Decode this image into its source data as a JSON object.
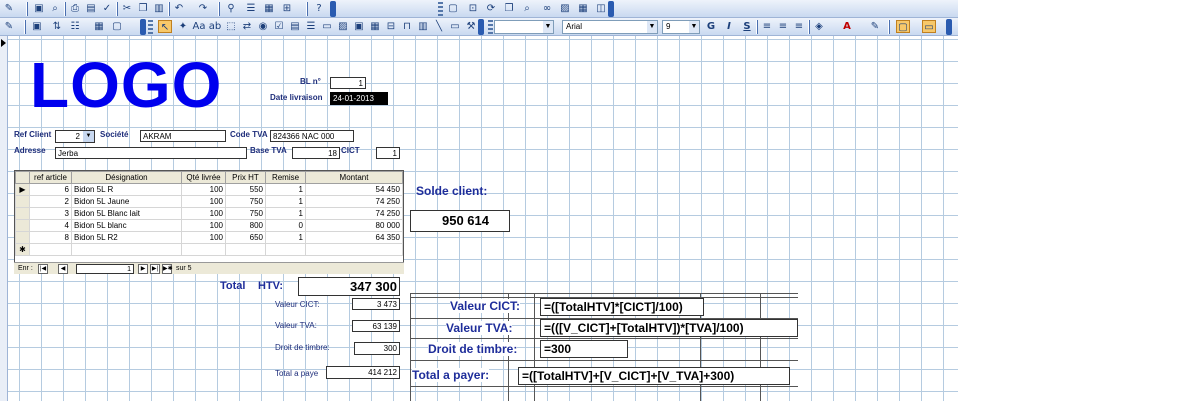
{
  "toolbar": {
    "font_name": "Arial",
    "font_size": "9"
  },
  "logo_text": "LOGO",
  "header": {
    "bl_label": "BL n°",
    "bl_value": "1",
    "date_label": "Date livraison",
    "date_value": "24-01-2013"
  },
  "client": {
    "ref_label": "Ref Client",
    "ref_value": "2",
    "societe_label": "Société",
    "societe_value": "AKRAM",
    "codetva_label": "Code TVA",
    "codetva_value": "824366 NAC 000",
    "adresse_label": "Adresse",
    "adresse_value": "Jerba",
    "basetva_label": "Base TVA",
    "basetva_value": "18",
    "cict_label": "CICT",
    "cict_value": "1"
  },
  "table": {
    "columns": [
      "ref article",
      "Désignation",
      "Qté livrée",
      "Prix HT",
      "Remise",
      "Montant"
    ],
    "rows": [
      {
        "ref": "6",
        "designation": "Bidon 5L R",
        "qte": "100",
        "prix": "550",
        "remise": "1",
        "montant": "54 450"
      },
      {
        "ref": "2",
        "designation": "Bidon 5L Jaune",
        "qte": "100",
        "prix": "750",
        "remise": "1",
        "montant": "74 250"
      },
      {
        "ref": "3",
        "designation": "Bidon 5L Blanc lait",
        "qte": "100",
        "prix": "750",
        "remise": "1",
        "montant": "74 250"
      },
      {
        "ref": "4",
        "designation": "Bidon 5L blanc",
        "qte": "100",
        "prix": "800",
        "remise": "0",
        "montant": "80 000"
      },
      {
        "ref": "8",
        "designation": "Bidon 5L R2",
        "qte": "100",
        "prix": "650",
        "remise": "1",
        "montant": "64 350"
      }
    ],
    "nav_label": "Enr :",
    "nav_current": "1",
    "nav_total": "sur 5"
  },
  "solde": {
    "label": "Solde client:",
    "value": "950 614"
  },
  "totals": {
    "total_label": "Total",
    "htv_label": "HTV:",
    "htv_value": "347 300",
    "cict_label": "Valeur CICT:",
    "cict_value": "3 473",
    "tva_label": "Valeur TVA:",
    "tva_value": "63 139",
    "timbre_label": "Droit de timbre:",
    "timbre_value": "300",
    "payer_label": "Total a paye",
    "payer_value": "414 212"
  },
  "formulas": {
    "cict_label": "Valeur CICT:",
    "cict_expr": "=([TotalHTV]*[CICT]/100)",
    "tva_label": "Valeur TVA:",
    "tva_expr": "=(([V_CICT]+[TotalHTV])*[TVA]/100)",
    "timbre_label": "Droit de timbre:",
    "timbre_expr": "=300",
    "payer_label": "Total a payer:",
    "payer_expr": "=([TotalHTV]+[V_CICT]+[V_TVA]+300)"
  }
}
